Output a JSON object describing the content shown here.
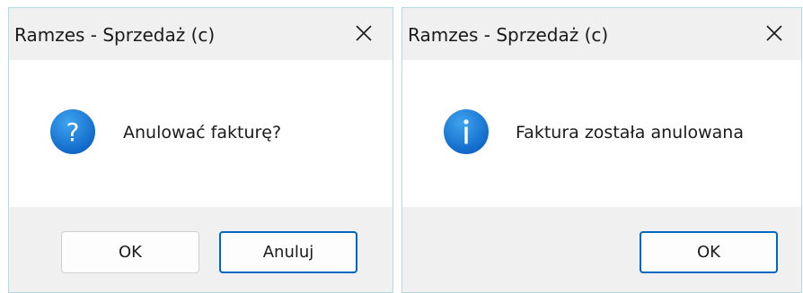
{
  "dialog1": {
    "title": "Ramzes - Sprzedaż (c)",
    "icon": "question-icon",
    "message": "Anulować fakturę?",
    "buttons": {
      "ok": "OK",
      "cancel": "Anuluj"
    }
  },
  "dialog2": {
    "title": "Ramzes - Sprzedaż (c)",
    "icon": "info-icon",
    "message": "Faktura została anulowana",
    "buttons": {
      "ok": "OK"
    }
  },
  "colors": {
    "icon_blue": "#1a7fd6",
    "primary_border": "#0067c0",
    "footer_bg": "#f0f0f0",
    "content_bg": "#ffffff"
  }
}
